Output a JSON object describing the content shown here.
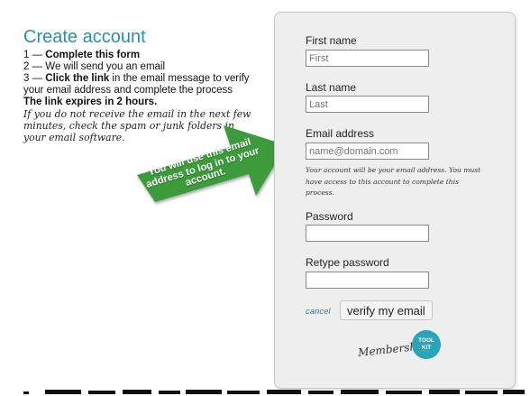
{
  "intro": {
    "title": "Create account",
    "steps": [
      {
        "prefix": "1 — ",
        "bold": "Complete this form",
        "rest": ""
      },
      {
        "prefix": "2 — ",
        "bold": "",
        "rest": "We will send you an email"
      },
      {
        "prefix": "3 — ",
        "bold": "Click the link",
        "rest": " in the email message to verify your email address and complete the process"
      }
    ],
    "expire_note": "The link expires in 2 hours.",
    "spam_note": "If you do not receive the email in the next few minutes, check the spam or junk folders in your email software."
  },
  "callout": {
    "text": "You will use this email address to log in to your account.",
    "color": "#3d9b3a"
  },
  "form": {
    "first_name": {
      "label": "First name",
      "placeholder": "First"
    },
    "last_name": {
      "label": "Last name",
      "placeholder": "Last"
    },
    "email": {
      "label": "Email address",
      "placeholder": "name@domain.com"
    },
    "email_help": "Your account will be your email address. You must have access to this account to complete this process.",
    "password": {
      "label": "Password",
      "placeholder": ""
    },
    "retype_password": {
      "label": "Retype password",
      "placeholder": ""
    },
    "cancel_label": "cancel",
    "verify_label": "verify my email"
  },
  "logo": {
    "script_text": "Membership",
    "badge_line1": "TOOL",
    "badge_line2": "KIT",
    "badge_color": "#2aa4b8"
  },
  "colors": {
    "title": "#2e8fa8",
    "panel_background": "#eeeeee",
    "link": "#2e7aa8"
  }
}
